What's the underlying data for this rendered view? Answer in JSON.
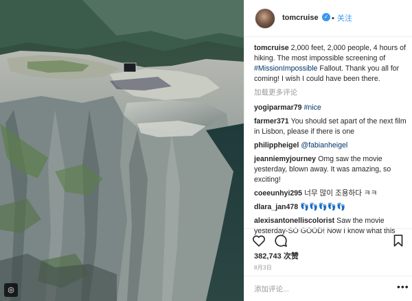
{
  "post": {
    "photo_badge_icon": "instagram-logo-icon",
    "header": {
      "username": "tomcruise",
      "verified_icon": "verified-badge-icon",
      "follow_label": "关注",
      "separator": "•"
    },
    "caption": {
      "user": "tomcruise",
      "text_before": "2,000 feet, 2,000 people, 4 hours of hiking. The most impossible screening of ",
      "hashtag": "#MissionImpossible",
      "text_after": " Fallout. Thank you all for coming! I wish I could have been there."
    },
    "load_more": "加载更多评论",
    "comments": [
      {
        "user": "yogiparmar79",
        "text": "#nice"
      },
      {
        "user": "farmer371",
        "text": "You should set apart of the next film in Lisbon, please if there is one"
      },
      {
        "user": "philippheigel",
        "text": "@fabianheigel"
      },
      {
        "user": "jeanniemyjourney",
        "text": "Omg saw the movie yesterday, blown away. It was amazing, so exciting!"
      },
      {
        "user": "coeeunhyi295",
        "text": "너무 많이 조용하다 ㅋㅋ"
      },
      {
        "user": "dlara_jan478",
        "text": "👣👣👣👣👣"
      },
      {
        "user": "alexisantonelliscolorist",
        "text": "Saw the movie yesterday-SO GOOD! Now I know what this"
      }
    ],
    "actions": {
      "like_icon": "heart-icon",
      "comment_icon": "comment-bubble-icon",
      "save_icon": "bookmark-icon"
    },
    "likes": "382,743 次赞",
    "date": "8月3日",
    "add_comment_placeholder": "添加评论...",
    "more_label": "•••"
  }
}
